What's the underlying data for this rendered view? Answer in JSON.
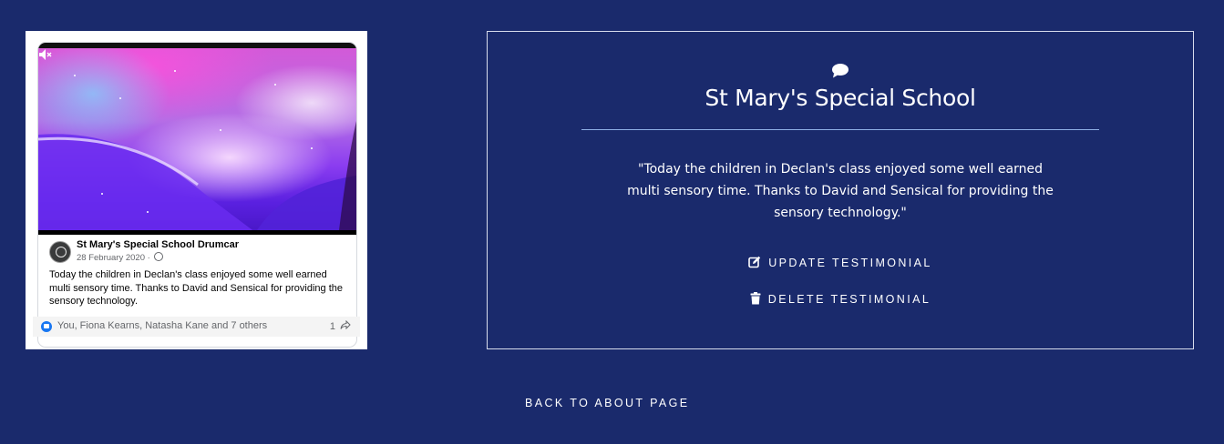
{
  "colors": {
    "page_background": "#1a2a6c",
    "text": "#ffffff",
    "divider": "#8fb0e6",
    "facebook_blue": "#1877f2"
  },
  "post": {
    "author": "St Mary's Special School Drumcar",
    "date": "28 February 2020 ·",
    "text": "Today the children in Declan's class enjoyed some well earned multi sensory time. Thanks to David and Sensical for providing the sensory technology.",
    "reactions": "You, Fiona Kearns, Natasha Kane and 7 others",
    "shares": "1",
    "icons": {
      "mute": "speaker-muted-icon",
      "globe": "globe-icon",
      "like": "like-icon",
      "share": "share-icon",
      "avatar": "school-crest-avatar"
    }
  },
  "testimonial": {
    "icon": "comment-icon",
    "title": "St Mary's Special School",
    "quote": "\"Today the children in Declan's class enjoyed some well earned multi sensory time. Thanks to David and Sensical for providing the sensory technology.\"",
    "update_label": "UPDATE TESTIMONIAL",
    "update_icon": "edit-icon",
    "delete_label": "DELETE TESTIMONIAL",
    "delete_icon": "trash-icon"
  },
  "back_link": "BACK TO ABOUT PAGE"
}
